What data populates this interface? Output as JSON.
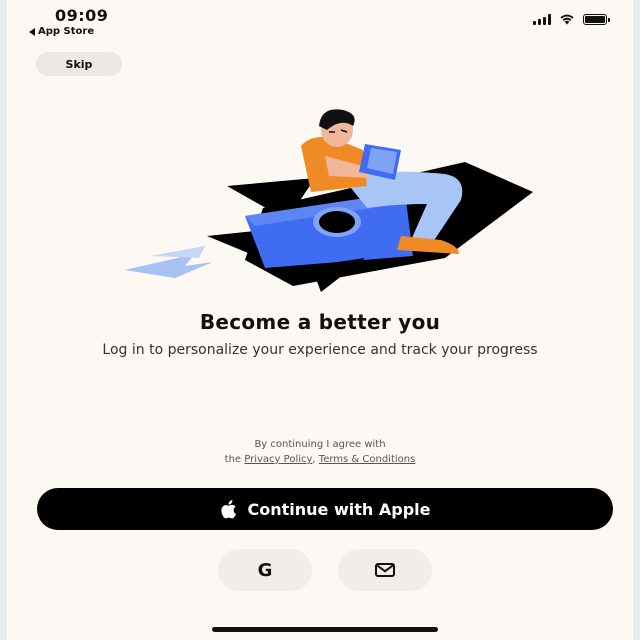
{
  "status_bar": {
    "time": "09:09",
    "back_label": "App Store"
  },
  "header": {
    "skip_label": "Skip"
  },
  "main": {
    "title": "Become a better you",
    "subtitle": "Log in to personalize your experience and track your progress"
  },
  "legal": {
    "line1": "By continuing I agree with",
    "prefix": "the ",
    "privacy_label": "Privacy Policy",
    "separator": ", ",
    "terms_label": "Terms & Conditions"
  },
  "auth": {
    "apple_label": "Continue with Apple",
    "google_icon": "G",
    "email_icon": "envelope-icon"
  },
  "colors": {
    "background": "#fcf8f4",
    "primary_button": "#000000",
    "rocket_blue": "#3f6cf0",
    "accent_orange": "#f08a24"
  }
}
